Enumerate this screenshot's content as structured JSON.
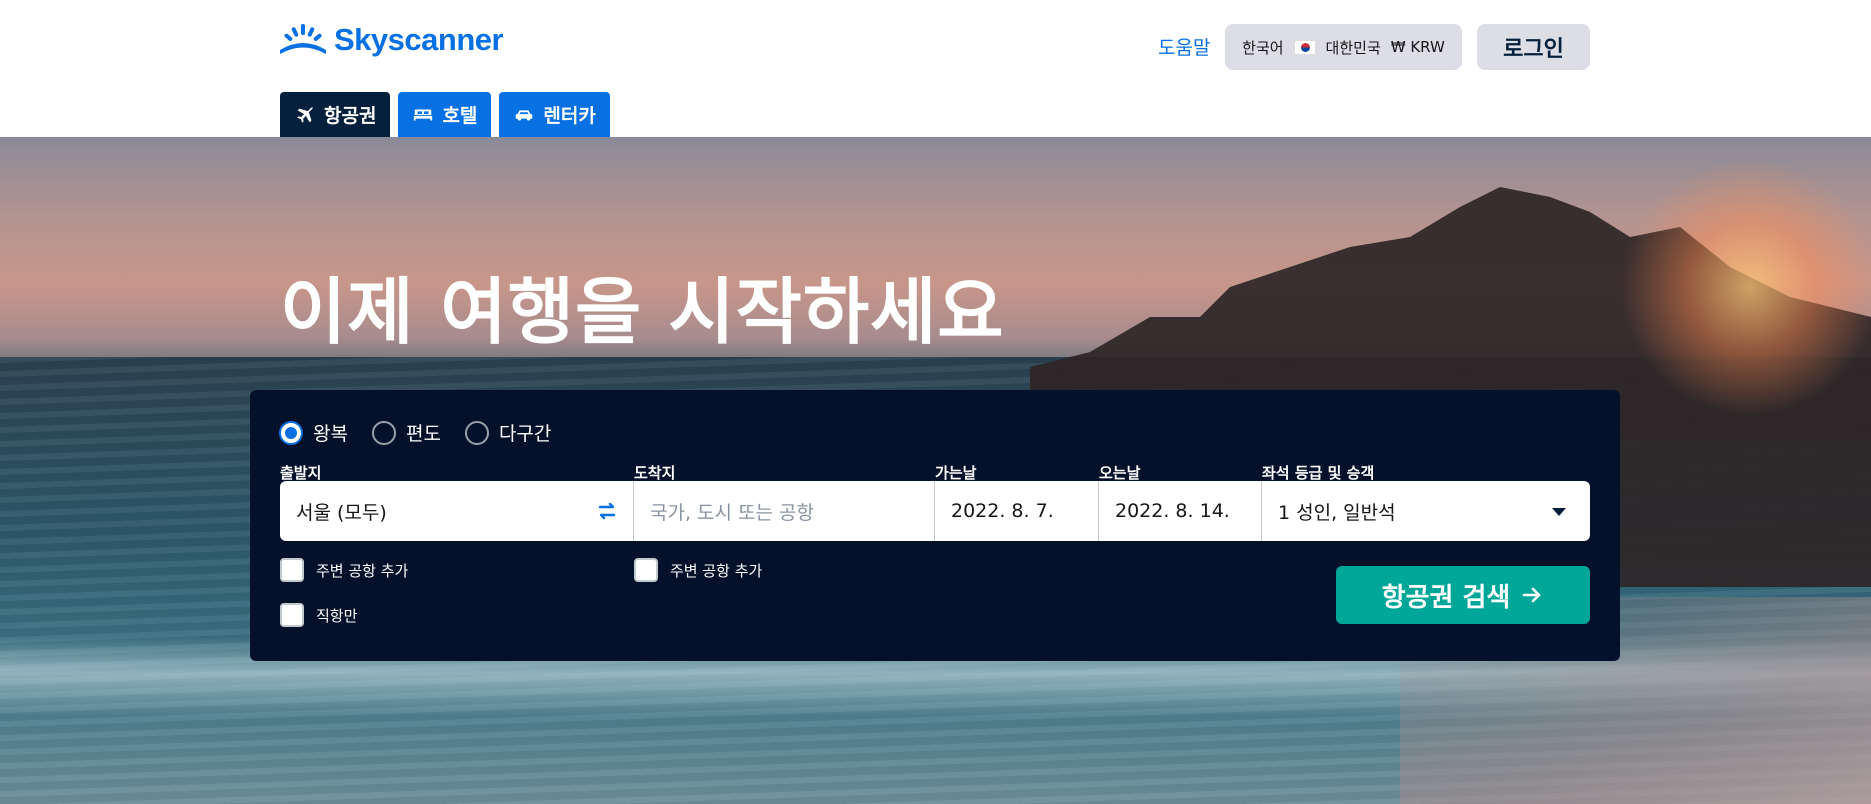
{
  "header": {
    "logo_text": "Skyscanner",
    "help": "도움말",
    "locale": {
      "language": "한국어",
      "country": "대한민국",
      "currency": "₩ KRW"
    },
    "login": "로그인"
  },
  "tabs": [
    {
      "label": "항공권",
      "icon": "airplane-icon",
      "active": true
    },
    {
      "label": "호텔",
      "icon": "bed-icon",
      "active": false
    },
    {
      "label": "렌터카",
      "icon": "car-icon",
      "active": false
    }
  ],
  "hero": {
    "headline": "이제 여행을 시작하세요"
  },
  "search": {
    "trip_types": [
      {
        "label": "왕복",
        "checked": true
      },
      {
        "label": "편도",
        "checked": false
      },
      {
        "label": "다구간",
        "checked": false
      }
    ],
    "labels": {
      "origin": "출발지",
      "destination": "도착지",
      "depart": "가는날",
      "return": "오는날",
      "cabin": "좌석 등급 및 승객"
    },
    "origin_value": "서울 (모두)",
    "destination_placeholder": "국가, 도시 또는 공항",
    "depart_value": "2022. 8. 7.",
    "return_value": "2022. 8. 14.",
    "cabin_value": "1 성인, 일반석",
    "nearby_origin": "주변 공항 추가",
    "nearby_destination": "주변 공항 추가",
    "direct_only": "직항만",
    "search_button": "항공권 검색"
  },
  "colors": {
    "brand": "#0770e3",
    "panel": "#05112a",
    "active_tab": "#05203c",
    "search_button": "#00a698"
  }
}
